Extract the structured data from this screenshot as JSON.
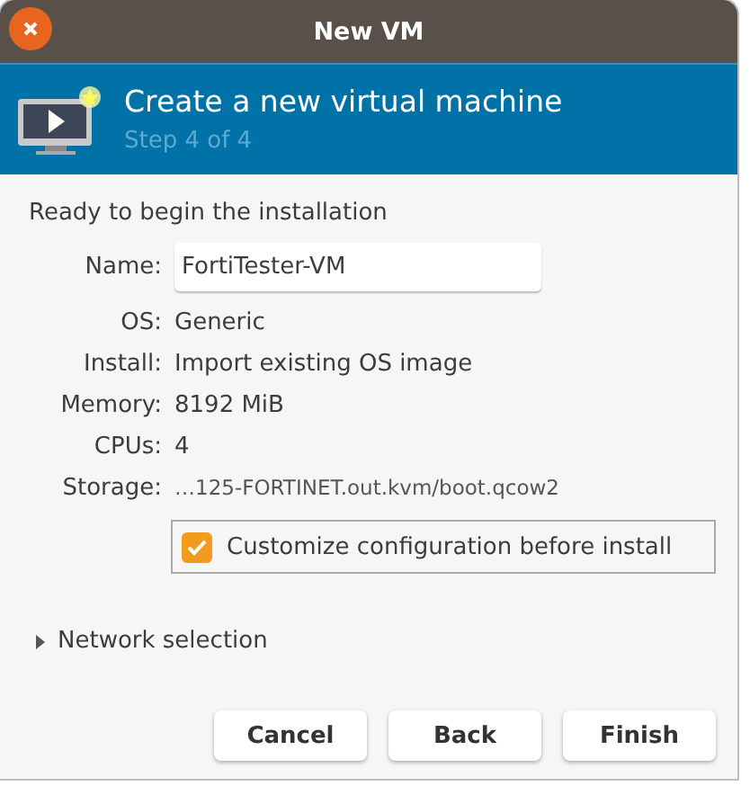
{
  "window": {
    "title": "New VM"
  },
  "header": {
    "title": "Create a new virtual machine",
    "subtitle": "Step 4 of 4"
  },
  "heading": "Ready to begin the installation",
  "fields": [
    {
      "kind": "entry",
      "label": "Name:",
      "value": "FortiTester-VM"
    },
    {
      "kind": "text",
      "label": "OS:",
      "value": "Generic"
    },
    {
      "kind": "text",
      "label": "Install:",
      "value": "Import existing OS image"
    },
    {
      "kind": "text",
      "label": "Memory:",
      "value": "8192 MiB"
    },
    {
      "kind": "text",
      "label": "CPUs:",
      "value": "4"
    },
    {
      "kind": "small",
      "label": "Storage:",
      "value": "…125-FORTINET.out.kvm/boot.qcow2"
    }
  ],
  "customize": {
    "label": "Customize configuration before install",
    "checked": true
  },
  "network": {
    "label": "Network selection",
    "expanded": false
  },
  "buttons": [
    "Cancel",
    "Back",
    "Finish"
  ]
}
